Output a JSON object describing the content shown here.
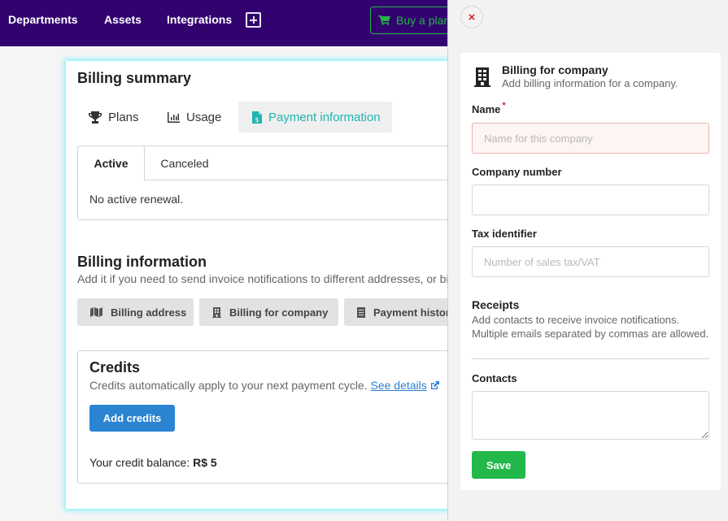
{
  "topnav": {
    "items": [
      "Departments",
      "Assets",
      "Integrations"
    ],
    "buy_plan_label": "Buy a plan"
  },
  "billing": {
    "title": "Billing summary",
    "tabs": [
      {
        "label": "Plans",
        "icon": "trophy-icon"
      },
      {
        "label": "Usage",
        "icon": "bar-chart-icon"
      },
      {
        "label": "Payment information",
        "icon": "invoice-dollar-icon",
        "active": true
      }
    ],
    "status_tabs": [
      {
        "label": "Active",
        "active": true
      },
      {
        "label": "Canceled"
      }
    ],
    "status_text": "No active renewal."
  },
  "billing_info": {
    "title": "Billing information",
    "description": "Add it if you need to send invoice notifications to different addresses, or bill to a company.",
    "buttons": [
      {
        "label": "Billing address",
        "icon": "map-icon"
      },
      {
        "label": "Billing for company",
        "icon": "building-icon"
      },
      {
        "label": "Payment history",
        "icon": "receipt-icon"
      }
    ]
  },
  "credits": {
    "title": "Credits",
    "description": "Credits automatically apply to your next payment cycle.",
    "link_label": "See details",
    "add_button": "Add credits",
    "balance_label": "Your credit balance:",
    "balance_value": "R$ 5"
  },
  "drawer": {
    "close_label": "×",
    "title": "Billing for company",
    "subtitle": "Add billing information for a company.",
    "fields": {
      "name": {
        "label": "Name",
        "required_mark": "*",
        "placeholder": "Name for this company",
        "value": ""
      },
      "company_number": {
        "label": "Company number",
        "placeholder": "",
        "value": ""
      },
      "tax_identifier": {
        "label": "Tax identifier",
        "placeholder": "Number of sales tax/VAT",
        "value": ""
      }
    },
    "receipts": {
      "title": "Receipts",
      "description": "Add contacts to receive invoice notifications. Multiple emails separated by commas are allowed."
    },
    "contacts_label": "Contacts",
    "contacts_value": "",
    "save_label": "Save"
  },
  "colors": {
    "nav_bg": "#32036f",
    "accent_teal": "#1fb5b0",
    "primary_blue": "#2a84d2",
    "success_green": "#22b84a",
    "danger_red": "#d9292c"
  }
}
